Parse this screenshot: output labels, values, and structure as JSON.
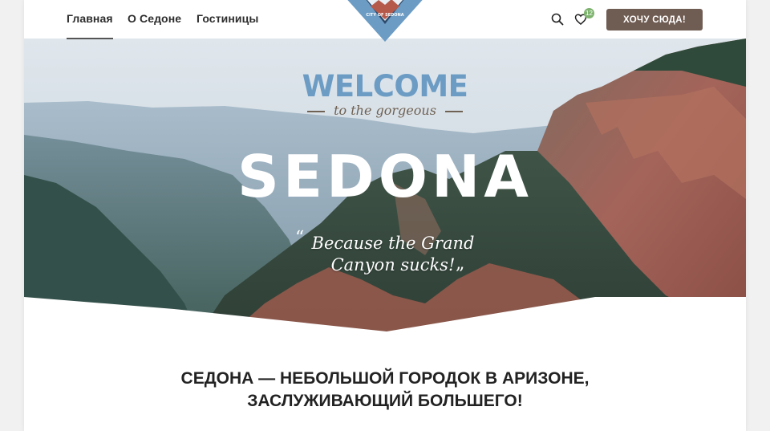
{
  "nav": {
    "links": [
      "Главная",
      "О Седоне",
      "Гостиницы"
    ],
    "active_index": 0,
    "favorites_count": "12",
    "cta_label": "ХОЧУ СЮДА!",
    "logo_text": "CITY OF SEDONA"
  },
  "hero": {
    "welcome": "WELCOME",
    "subtitle": "to the gorgeous",
    "city": "SEDONA",
    "tagline_line1": "Because the Grand",
    "tagline_line2": "Canyon sucks!",
    "quote_open": "“",
    "quote_close": "„"
  },
  "main": {
    "heading_line1": "СЕДОНА — НЕБОЛЬШОЙ ГОРОДОК В АРИЗОНЕ,",
    "heading_line2": "ЗАСЛУЖИВАЮЩИЙ БОЛЬШЕГО!"
  },
  "colors": {
    "accent_blue": "#6c9cc4",
    "cta_brown": "#6f5c52",
    "badge_green": "#7db36e"
  }
}
